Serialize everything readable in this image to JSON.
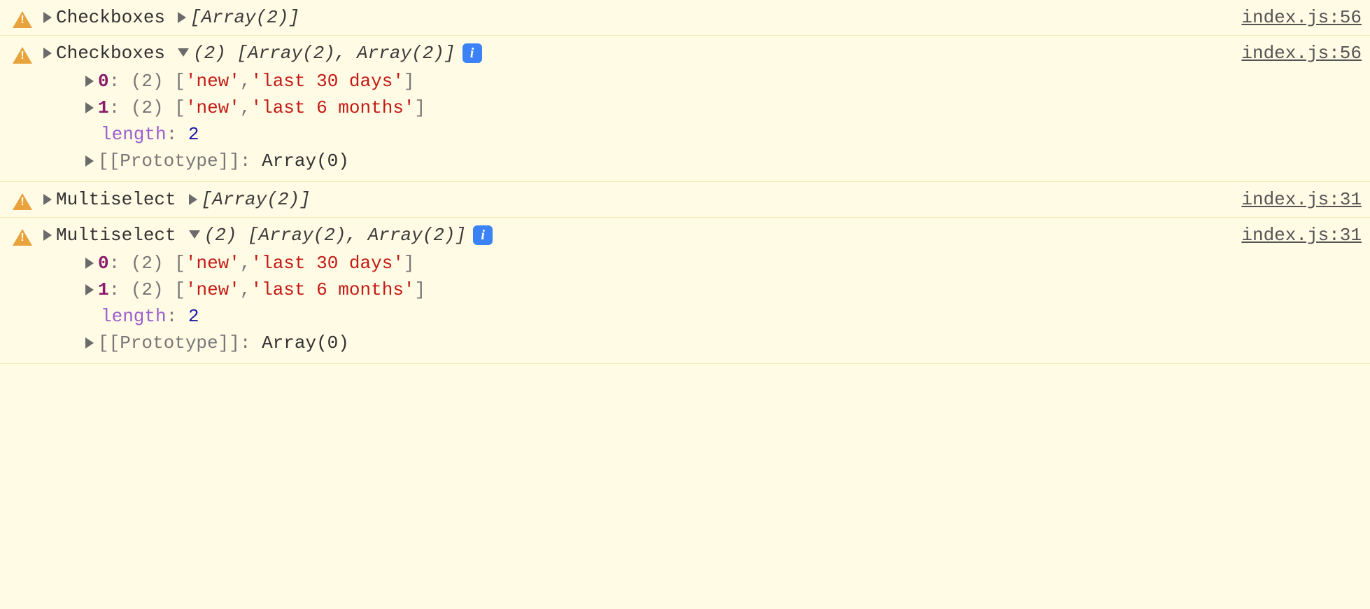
{
  "glyph": {
    "info": "i"
  },
  "entries": [
    {
      "kind": "collapsed",
      "label": "Checkboxes",
      "summary": "[Array(2)]",
      "source": "index.js:56"
    },
    {
      "kind": "expanded",
      "label": "Checkboxes",
      "summary_count": "(2)",
      "summary_body": "[Array(2), Array(2)]",
      "source": "index.js:56",
      "items": [
        {
          "index": "0",
          "count": "(2)",
          "open": "[",
          "v0": "'new'",
          "sep": ", ",
          "v1": "'last 30 days'",
          "close": "]"
        },
        {
          "index": "1",
          "count": "(2)",
          "open": "[",
          "v0": "'new'",
          "sep": ", ",
          "v1": "'last 6 months'",
          "close": "]"
        }
      ],
      "length_label": "length",
      "length_value": "2",
      "proto_label": "[[Prototype]]",
      "proto_value": "Array(0)"
    },
    {
      "kind": "collapsed",
      "label": "Multiselect",
      "summary": "[Array(2)]",
      "source": "index.js:31"
    },
    {
      "kind": "expanded",
      "label": "Multiselect",
      "summary_count": "(2)",
      "summary_body": "[Array(2), Array(2)]",
      "source": "index.js:31",
      "items": [
        {
          "index": "0",
          "count": "(2)",
          "open": "[",
          "v0": "'new'",
          "sep": ", ",
          "v1": "'last 30 days'",
          "close": "]"
        },
        {
          "index": "1",
          "count": "(2)",
          "open": "[",
          "v0": "'new'",
          "sep": ", ",
          "v1": "'last 6 months'",
          "close": "]"
        }
      ],
      "length_label": "length",
      "length_value": "2",
      "proto_label": "[[Prototype]]",
      "proto_value": "Array(0)"
    }
  ]
}
